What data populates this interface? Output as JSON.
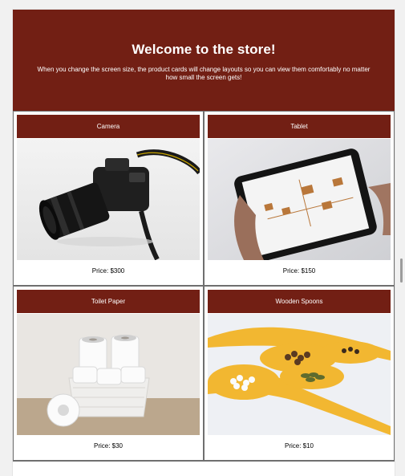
{
  "hero": {
    "title": "Welcome to the store!",
    "subtitle": "When you change the screen size, the product cards will change layouts so you can view them comfortably no matter how small the screen gets!"
  },
  "products": [
    {
      "name": "Camera",
      "price": "Price: $300",
      "image_icon": "camera-photo"
    },
    {
      "name": "Tablet",
      "price": "Price: $150",
      "image_icon": "tablet-photo"
    },
    {
      "name": "Toilet Paper",
      "price": "Price: $30",
      "image_icon": "toilet-paper-photo"
    },
    {
      "name": "Wooden Spoons",
      "price": "Price: $10",
      "image_icon": "wooden-spoons-photo"
    }
  ],
  "colors": {
    "brand": "#721f14",
    "card_border": "#6f6f6f"
  }
}
